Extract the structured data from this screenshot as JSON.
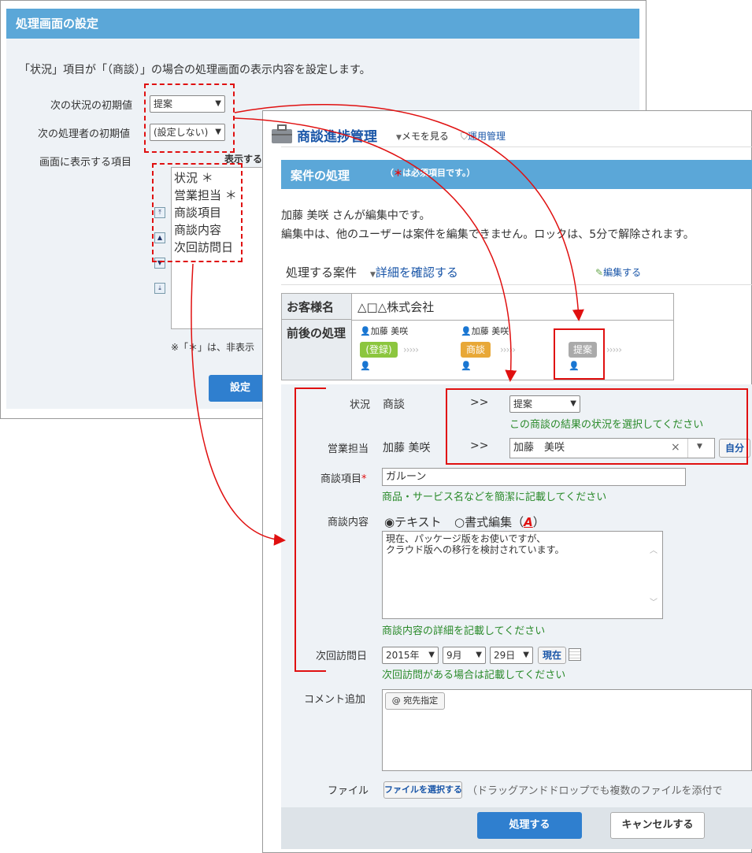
{
  "back": {
    "title": "処理画面の設定",
    "description": "「状況」項目が「（商談）」の場合の処理画面の表示内容を設定します。",
    "next_status_label": "次の状況の初期値",
    "next_status_value": "提案",
    "next_handler_label": "次の処理者の初期値",
    "next_handler_value": "(設定しない)",
    "display_items_label": "画面に表示する項目",
    "display_header": "表示する",
    "display_items": [
      "状況 ＊",
      "営業担当 ＊",
      "商談項目",
      "商談内容",
      "次回訪問日"
    ],
    "note": "※「＊」は、非表示",
    "set_button": "設定"
  },
  "front": {
    "app_title": "商談進捗管理",
    "memo_link": "メモを見る",
    "admin_link": "運用管理",
    "section_title": "案件の処理",
    "required_note_star": "＊",
    "required_note": "は必須項目です。）",
    "required_note_open": "（",
    "editing_msg1": "加藤 美咲 さんが編集中です。",
    "editing_msg2": "編集中は、他のユーザーは案件を編集できません。ロックは、5分で解除されます。",
    "case_label": "処理する案件",
    "detail_link": "詳細を確認する",
    "edit_link": "編集する",
    "customer_label": "お客様名",
    "customer_value": "△□△株式会社",
    "flow_label": "前後の処理",
    "flow": [
      {
        "user": "加藤 美咲",
        "status": "(登録)",
        "color": "#8cc63f"
      },
      {
        "user": "加藤 美咲",
        "status": "商談",
        "color": "#e8a838"
      },
      {
        "user": "",
        "status": "提案",
        "color": "#aaaaaa"
      }
    ],
    "status_label": "状況",
    "status_current": "商談",
    "arrow": ">>",
    "status_next": "提案",
    "status_hint": "この商談の結果の状況を選択してください",
    "sales_label": "営業担当",
    "sales_current": "加藤 美咲",
    "sales_next": "加藤　美咲",
    "self_button": "自分",
    "item_label": "商談項目",
    "item_value": "ガルーン",
    "item_hint": "商品・サービス名などを簡潔に記載してください",
    "content_label": "商談内容",
    "radio_text": "テキスト",
    "radio_format": "書式編集",
    "format_icon": "A",
    "content_line1": "現在、パッケージ版をお使いですが、",
    "content_line2": "クラウド版への移行を検討されています。",
    "content_hint": "商談内容の詳細を記載してください",
    "visit_label": "次回訪問日",
    "visit_year": "2015年",
    "visit_month": "9月",
    "visit_day": "29日",
    "now_button": "現在",
    "visit_hint": "次回訪問がある場合は記載してください",
    "comment_label": "コメント追加",
    "mention_button": "@ 宛先指定",
    "file_label": "ファイル",
    "file_button": "ファイルを選択する",
    "file_hint": "（ドラッグアンドドロップでも複数のファイルを添付で",
    "process_button": "処理する",
    "cancel_button": "キャンセルする"
  },
  "colors": {
    "header_blue": "#5ba7d8",
    "red_annotation": "#e01010",
    "link_blue": "#1a56a8",
    "hint_green": "#2a8a2a",
    "primary_button": "#2f7fcf"
  }
}
